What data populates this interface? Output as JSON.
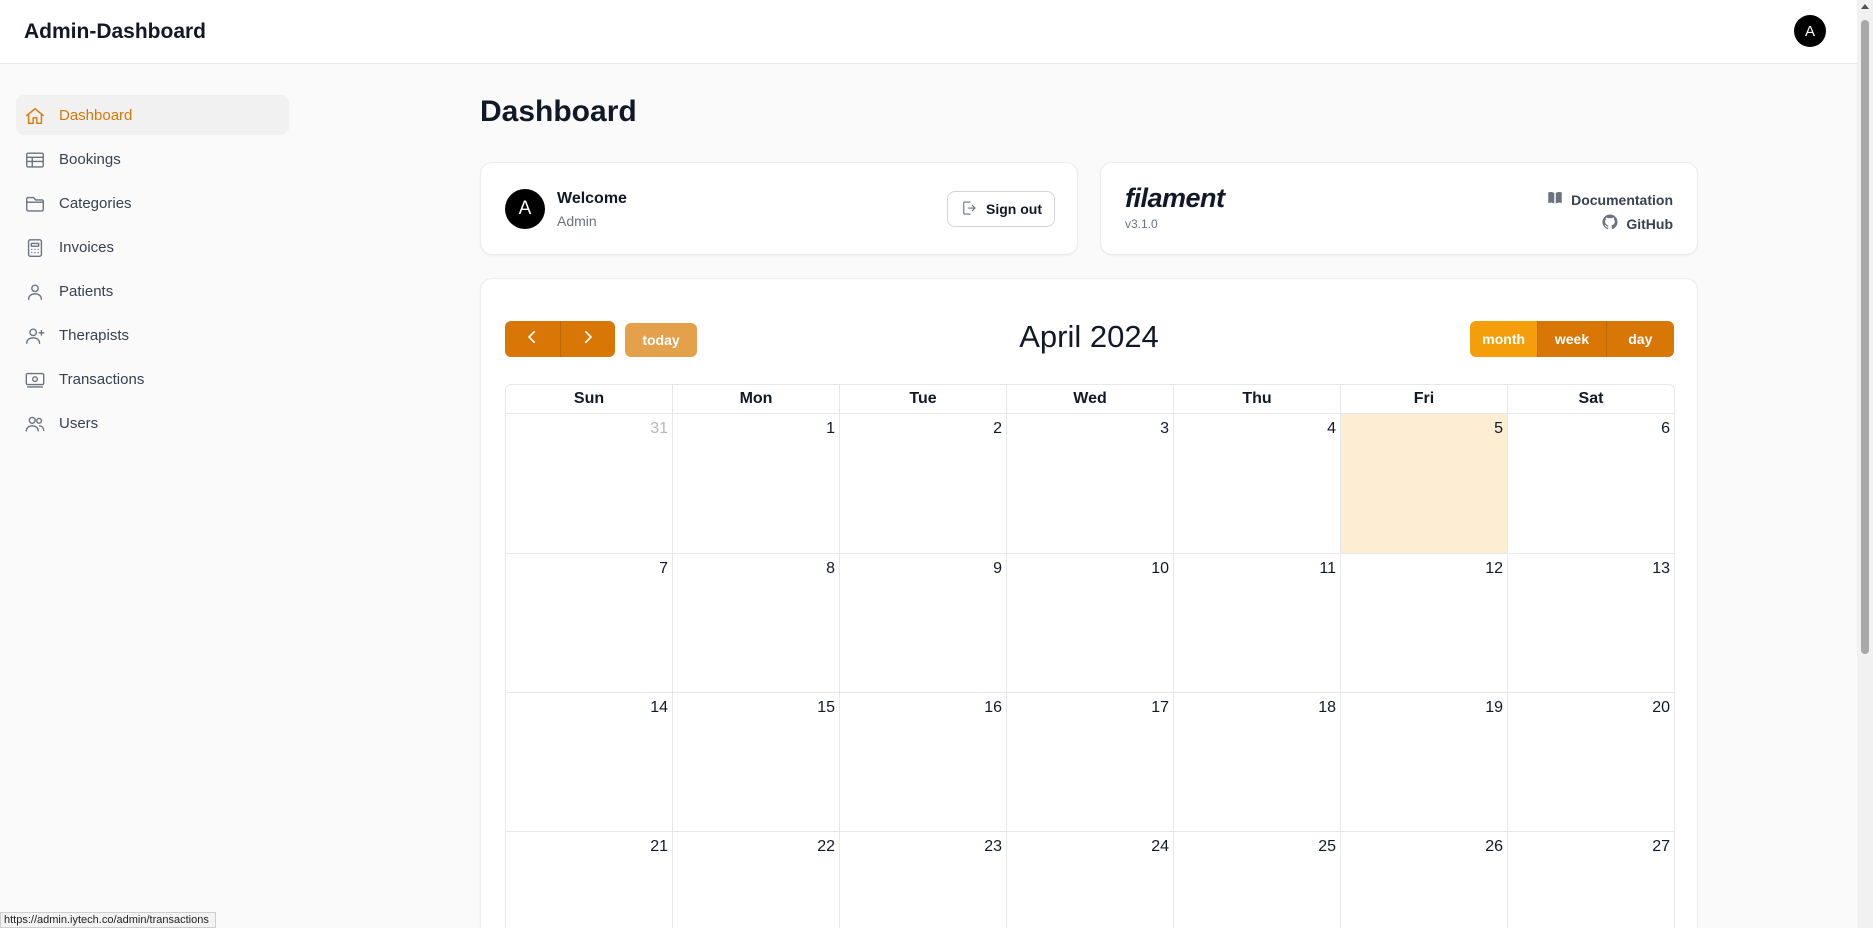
{
  "app": {
    "title": "Admin-Dashboard",
    "avatar_initial": "A"
  },
  "sidebar": {
    "items": [
      {
        "label": "Dashboard",
        "icon": "home-icon",
        "active": true
      },
      {
        "label": "Bookings",
        "icon": "table-icon"
      },
      {
        "label": "Categories",
        "icon": "folder-icon"
      },
      {
        "label": "Invoices",
        "icon": "calculator-icon"
      },
      {
        "label": "Patients",
        "icon": "user-icon"
      },
      {
        "label": "Therapists",
        "icon": "user-plus-icon"
      },
      {
        "label": "Transactions",
        "icon": "banknotes-icon"
      },
      {
        "label": "Users",
        "icon": "users-icon"
      }
    ]
  },
  "page": {
    "title": "Dashboard"
  },
  "welcome": {
    "avatar_initial": "A",
    "title": "Welcome",
    "user": "Admin",
    "signout_label": "Sign out"
  },
  "filament": {
    "logo": "filament",
    "version": "v3.1.0",
    "docs_label": "Documentation",
    "github_label": "GitHub"
  },
  "calendar": {
    "title": "April 2024",
    "today_label": "today",
    "views": [
      "month",
      "week",
      "day"
    ],
    "active_view": "month",
    "weekdays": [
      "Sun",
      "Mon",
      "Tue",
      "Wed",
      "Thu",
      "Fri",
      "Sat"
    ],
    "weeks": [
      [
        "31",
        "1",
        "2",
        "3",
        "4",
        "5",
        "6"
      ],
      [
        "7",
        "8",
        "9",
        "10",
        "11",
        "12",
        "13"
      ],
      [
        "14",
        "15",
        "16",
        "17",
        "18",
        "19",
        "20"
      ],
      [
        "21",
        "22",
        "23",
        "24",
        "25",
        "26",
        "27"
      ]
    ],
    "today": "5",
    "other_month": [
      "31"
    ],
    "colors": {
      "accent": "#d97706",
      "active_view": "#f59e0b",
      "today_bg": "#fdedd3"
    }
  },
  "status_bar": {
    "url": "https://admin.iytech.co/admin/transactions"
  }
}
